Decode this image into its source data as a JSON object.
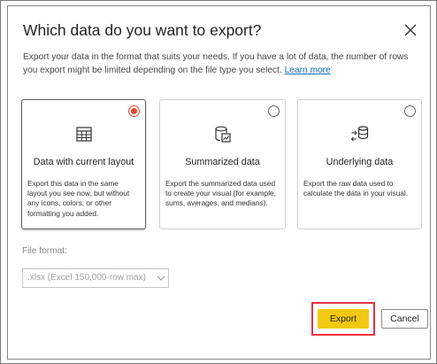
{
  "dialog": {
    "title": "Which data do you want to export?",
    "description": "Export your data in the format that suits your needs. If you have a lot of data, the number of rows you export might be limited depending on the file type you select.",
    "learn_more": "Learn more"
  },
  "options": [
    {
      "title": "Data with current layout",
      "description": "Export this data in the same layout you see now, but without any icons, colors, or other formatting you added.",
      "selected": true,
      "icon": "table-icon"
    },
    {
      "title": "Summarized data",
      "description": "Export the summarized data used to create your visual (for example, sums, averages, and medians).",
      "selected": false,
      "icon": "database-chart-icon"
    },
    {
      "title": "Underlying data",
      "description": "Export the raw data used to calculate the data in your visual.",
      "selected": false,
      "icon": "database-arrows-icon"
    }
  ],
  "file_format": {
    "label": "File format:",
    "value": ".xlsx (Excel 150,000-row max)"
  },
  "buttons": {
    "export": "Export",
    "cancel": "Cancel"
  },
  "colors": {
    "accent_radio": "#e8482e",
    "export_button": "#f2c811",
    "highlight_box": "#e8343f",
    "link": "#106ebe"
  }
}
